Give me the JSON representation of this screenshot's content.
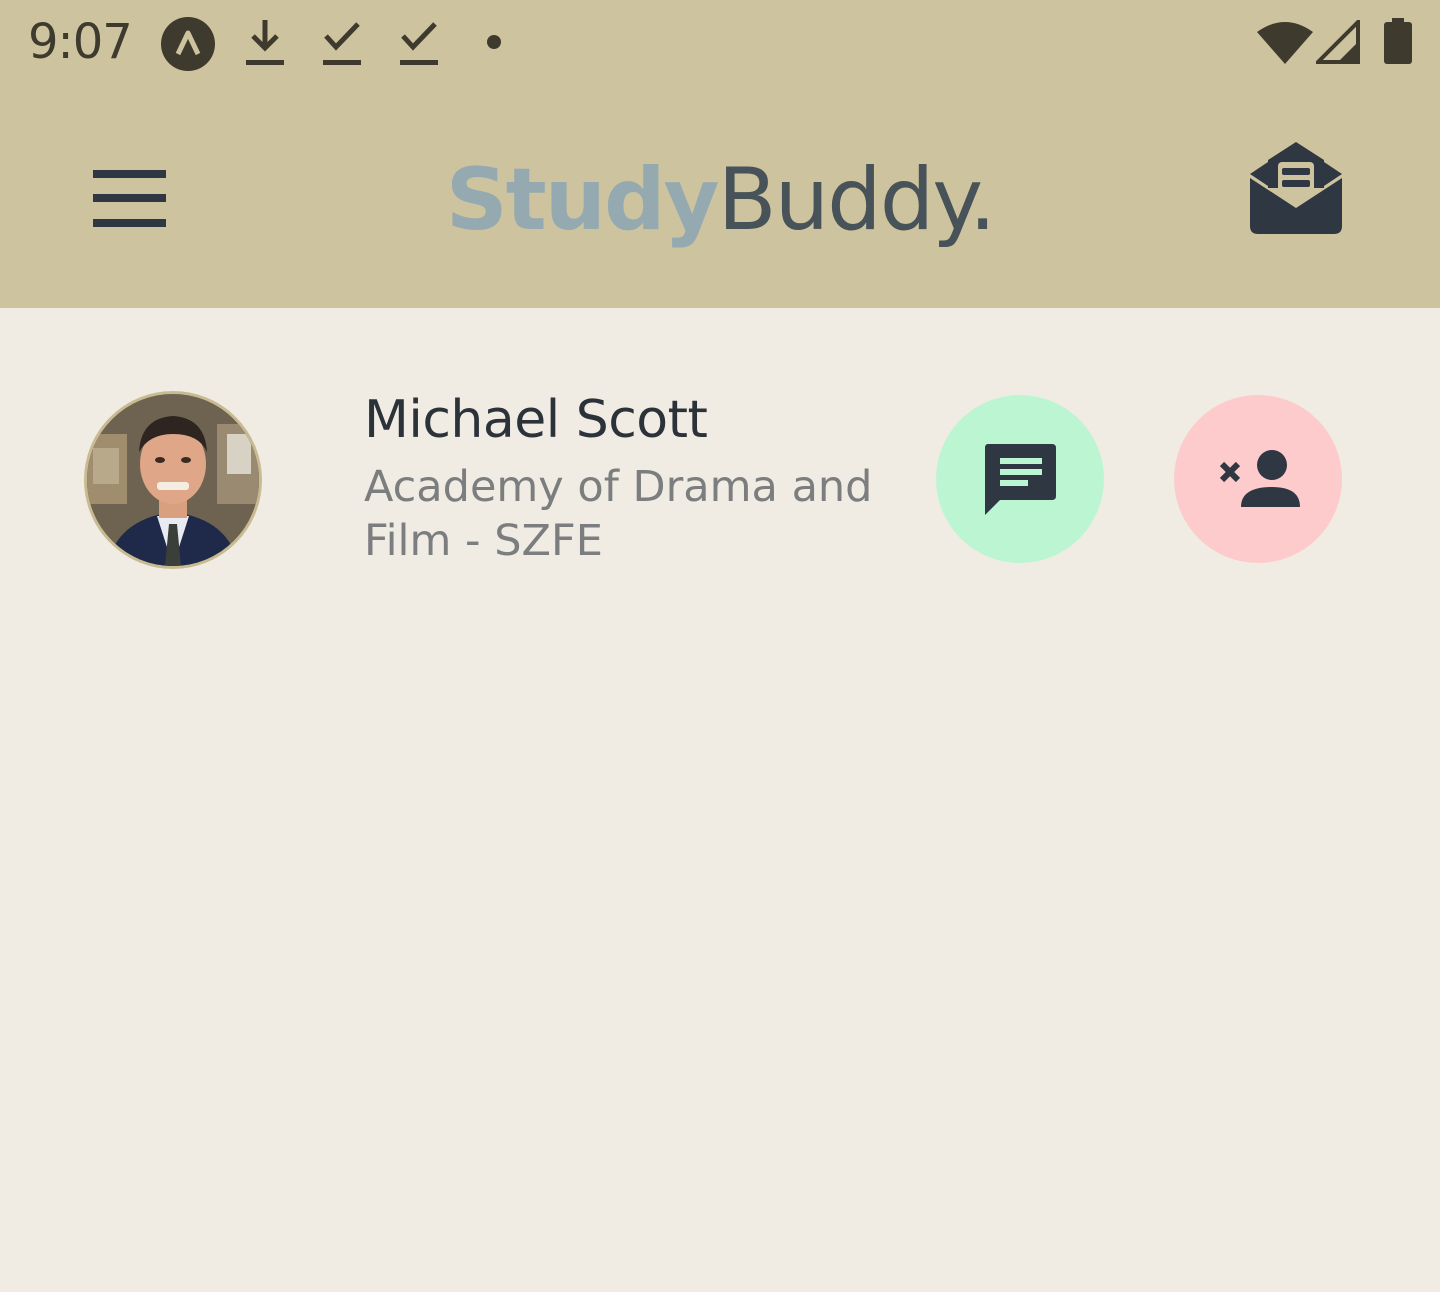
{
  "status_bar": {
    "time": "9:07",
    "icons": [
      "app-notification-icon",
      "download-icon",
      "download-done-icon",
      "download-done-icon",
      "dot-icon",
      "wifi-icon",
      "signal-icon",
      "battery-icon"
    ]
  },
  "app_bar": {
    "brand_study": "Study",
    "brand_buddy": "Buddy.",
    "menu_icon": "hamburger-menu-icon",
    "mail_icon": "open-envelope-icon"
  },
  "buddy": {
    "name": "Michael Scott",
    "school": "Academy of Drama and Film - SZFE",
    "chat_icon": "chat-icon",
    "remove_icon": "remove-person-icon"
  },
  "colors": {
    "header_bg": "#cdc39e",
    "page_bg": "#f0ece4",
    "chat_button": "#bcf5d2",
    "remove_button": "#fdcbcb",
    "icon_dark": "#2f3742"
  }
}
